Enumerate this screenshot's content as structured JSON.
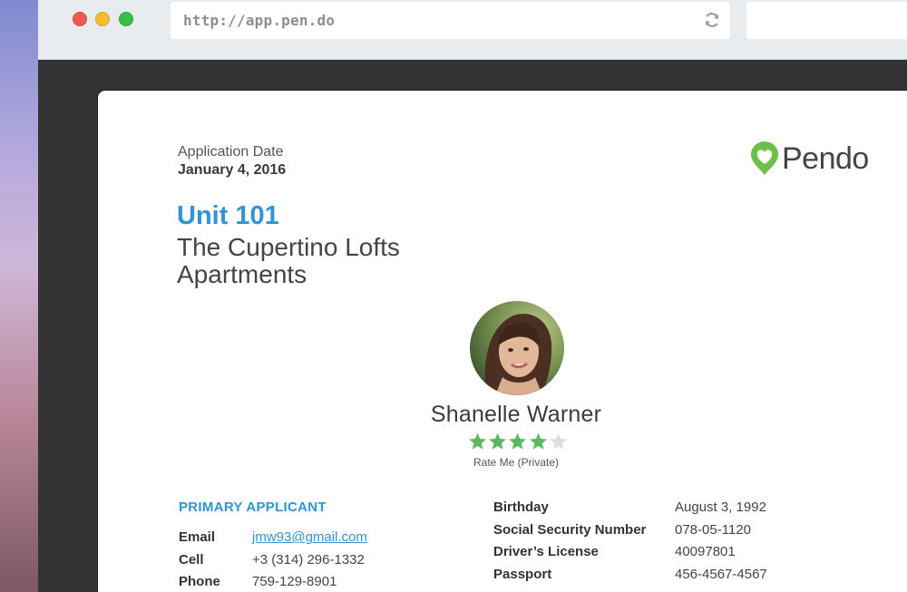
{
  "browser": {
    "url": "http://app.pen.do",
    "reload_icon": "reload-icon",
    "window_controls": [
      "close",
      "minimize",
      "maximize"
    ]
  },
  "page": {
    "application_date_label": "Application Date",
    "application_date": "January 4, 2016",
    "logo_text": "Pendo",
    "unit": "Unit 101",
    "property": "The Cupertino Lofts Apartments",
    "applicant_name": "Shanelle Warner",
    "rating": 4,
    "rating_max": 5,
    "rating_label": "Rate Me (Private)",
    "section_title": "PRIMARY APPLICANT",
    "contact": {
      "email_label": "Email",
      "email": "jmw93@gmail.com",
      "cell_label": "Cell",
      "cell": "+3 (314) 296-1332",
      "phone_label": "Phone",
      "phone": "759-129-8901"
    },
    "identity": {
      "birthday_label": "Birthday",
      "birthday": "August 3, 1992",
      "ssn_label": "Social Security Number",
      "ssn": "078-05-1120",
      "license_label": "Driver’s License",
      "license": "40097801",
      "passport_label": "Passport",
      "passport": "456-4567-4567"
    }
  },
  "colors": {
    "accent": "#2f95d8",
    "star_filled": "#5cb85c",
    "star_empty": "#dddddd",
    "logo_green": "#6cc04a"
  }
}
